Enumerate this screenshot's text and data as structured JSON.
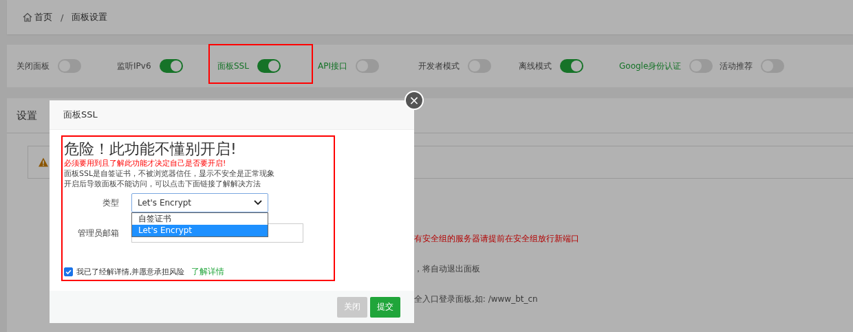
{
  "breadcrumb": [
    "首页",
    "面板设置"
  ],
  "breadcrumb_separator": "/",
  "switches": [
    {
      "label": "关闭面板",
      "on": false,
      "highlighted": false
    },
    {
      "label": "监听IPv6",
      "on": true,
      "highlighted": false
    },
    {
      "label": "面板SSL",
      "on": true,
      "highlighted": true
    },
    {
      "label": "API接口",
      "on": false,
      "highlighted": true
    },
    {
      "label": "开发者模式",
      "on": false,
      "highlighted": false
    },
    {
      "label": "离线模式",
      "on": true,
      "highlighted": false
    },
    {
      "label": "Google身份认证",
      "on": false,
      "highlighted": true
    },
    {
      "label": "活动推荐",
      "on": false,
      "highlighted": false
    }
  ],
  "settings": {
    "title": "设置",
    "rows": [
      {
        "text": "有安全组的服务器请提前在安全组放行新端口",
        "warning": true
      },
      {
        "text": "，将自动退出面板",
        "warning": false
      },
      {
        "text": "全入口登录面板,如: /www_bt_cn",
        "warning": false
      }
    ]
  },
  "dialog": {
    "title": "面板SSL",
    "close": "×",
    "heading": "危险！此功能不懂别开启!",
    "warning": "必须要用到且了解此功能才决定自己是否要开启!",
    "notes": [
      "面板SSL是自签证书，不被浏览器信任，显示不安全是正常现象",
      "开启后导致面板不能访问，可以点击下面链接了解解决方法"
    ],
    "type_label": "类型",
    "type_value": "Let's Encrypt",
    "type_options": [
      {
        "label": "自签证书",
        "selected": false
      },
      {
        "label": "Let's Encrypt",
        "selected": true
      }
    ],
    "email_label": "管理员邮箱",
    "agree": {
      "checked": true,
      "label": "我已了经解详情,并愿意承担风险",
      "link": "了解详情"
    },
    "buttons": [
      {
        "label": "关闭",
        "disabled": true
      },
      {
        "label": "提交",
        "disabled": false
      }
    ]
  }
}
